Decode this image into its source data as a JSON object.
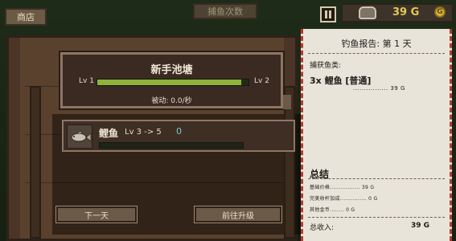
{
  "topbar": {
    "shop_label": "商店",
    "title_label": "捕鱼次数",
    "gold_amount": "39 G",
    "coin_symbol": "G"
  },
  "pond": {
    "title": "新手池塘",
    "lv_left": "Lv 1",
    "lv_right": "Lv 2",
    "progress_fraction": 0.95,
    "passive_label": "被动: 0.0/秒"
  },
  "fish": {
    "name": "鲤鱼",
    "level_text": "Lv 3 -> 5",
    "count": "0",
    "progress_fraction": 0.0
  },
  "buttons": {
    "next_day": "下一天",
    "go_upgrade": "前往升级"
  },
  "receipt": {
    "title": "钓鱼报告: 第 1 天",
    "caught_label": "捕获鱼类:",
    "item_text": "3x 鲤鱼 [普通]",
    "item_price": "................ 39 G",
    "summary_label": "总结",
    "sum_rows": [
      "基础价格................. 39 G",
      "完美收杆加成............... 0 G",
      "其他金币........ 0 G"
    ],
    "total_label": "总收入:",
    "total_value": "39 G"
  },
  "colors": {
    "gold": "#e2c85a",
    "progress_green": "#8fb33a",
    "receipt_border": "#b8392e"
  }
}
